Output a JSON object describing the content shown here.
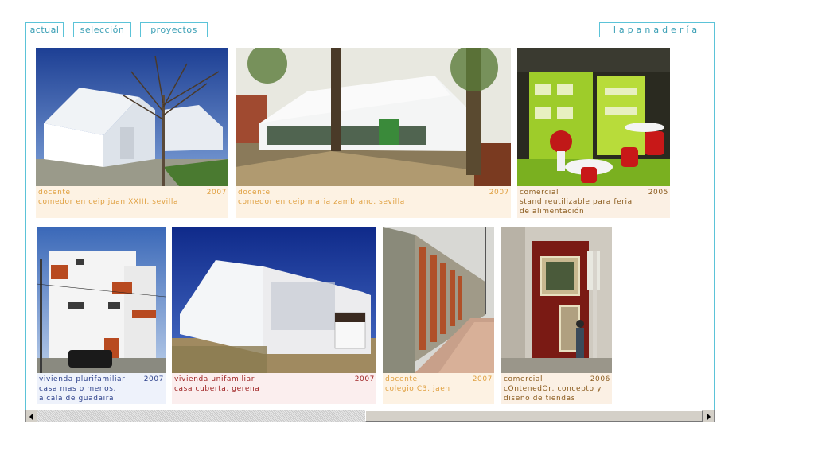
{
  "tabs": {
    "actual": "actual",
    "seleccion": "selección",
    "proyectos": "proyectos",
    "brand": "lapanadería"
  },
  "projects": [
    {
      "category": "docente",
      "year": "2007",
      "lines": [
        "comedor en ceip juan XXIII, sevilla"
      ]
    },
    {
      "category": "docente",
      "year": "2007",
      "lines": [
        "comedor en ceip maria zambrano, sevilla"
      ]
    },
    {
      "category": "comercial",
      "year": "2005",
      "lines": [
        "stand reutilizable para feria",
        "de alimentación"
      ]
    },
    {
      "category": "vivienda plurifamiliar",
      "year": "2007",
      "lines": [
        "casa mas o menos,",
        "alcala de guadaira"
      ]
    },
    {
      "category": "vivienda unifamiliar",
      "year": "2007",
      "lines": [
        "casa cuberta, gerena"
      ]
    },
    {
      "category": "docente",
      "year": "2007",
      "lines": [
        "colegio C3, jaen"
      ]
    },
    {
      "category": "comercial",
      "year": "2006",
      "lines": [
        "cOntenedOr, concepto y",
        "diseño de tiendas"
      ]
    }
  ],
  "colors": {
    "frame_border": "#5bc3d8",
    "tab_text": "#3a9fb5",
    "docente": "#e0a040",
    "comercial": "#8a5a1c",
    "plurifamiliar": "#2b3f8a",
    "unifamiliar": "#9e2222"
  }
}
